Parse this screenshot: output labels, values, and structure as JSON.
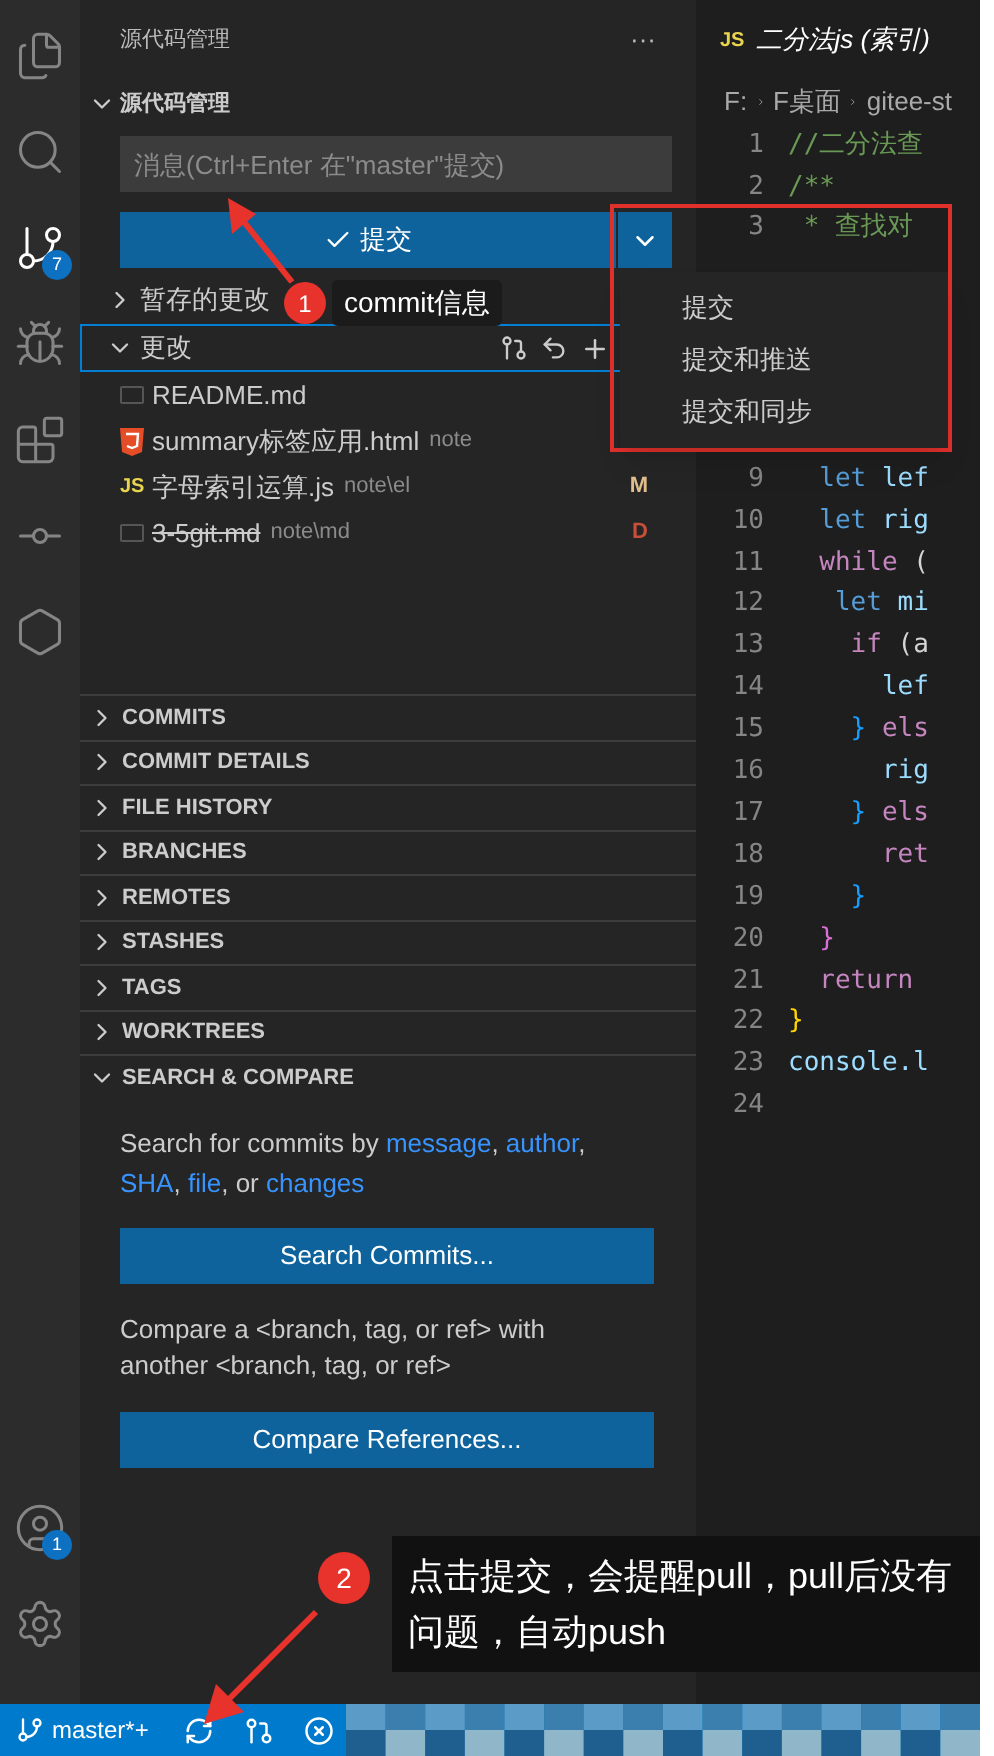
{
  "activity_bar": {
    "items": [
      {
        "kind": "files",
        "selected": false
      },
      {
        "kind": "search",
        "selected": false
      },
      {
        "kind": "scm",
        "selected": true,
        "badge": "7"
      },
      {
        "kind": "debug",
        "selected": false
      },
      {
        "kind": "extensions",
        "selected": false
      },
      {
        "kind": "gitlens",
        "selected": false
      },
      {
        "kind": "hexplay",
        "selected": false
      }
    ],
    "bottom": [
      {
        "kind": "account",
        "badge": "1"
      },
      {
        "kind": "settings"
      }
    ]
  },
  "sidebar": {
    "title": "源代码管理",
    "more": "···",
    "section": "源代码管理",
    "message_field": {
      "placeholder": "消息(Ctrl+Enter 在\"master\"提交)"
    },
    "commit_button": {
      "label": "提交"
    },
    "groups": [
      {
        "label": "暂存的更改",
        "focused": false
      },
      {
        "label": "更改",
        "focused": true
      }
    ],
    "files": [
      {
        "kind": "md",
        "name": "README.md",
        "deleted": false
      },
      {
        "kind": "html",
        "name": "summary标签应用.html",
        "path": "note",
        "deleted": false
      },
      {
        "kind": "js",
        "icon": "JS",
        "name": "字母索引运算.js",
        "path": "note\\el",
        "status": "M",
        "deleted": false
      },
      {
        "kind": "md",
        "name": "3-5git.md",
        "path": "note\\md",
        "status": "D",
        "deleted": true
      }
    ],
    "panels": [
      {
        "label": "COMMITS",
        "expanded": false
      },
      {
        "label": "COMMIT DETAILS",
        "expanded": false
      },
      {
        "label": "FILE HISTORY",
        "expanded": false
      },
      {
        "label": "BRANCHES",
        "expanded": false
      },
      {
        "label": "REMOTES",
        "expanded": false
      },
      {
        "label": "STASHES",
        "expanded": false
      },
      {
        "label": "TAGS",
        "expanded": false
      },
      {
        "label": "WORKTREES",
        "expanded": false
      },
      {
        "label": "SEARCH & COMPARE",
        "expanded": true
      }
    ],
    "search_text": [
      {
        "text": "Search for commits by ",
        "link": false
      },
      {
        "text": "message",
        "link": true
      },
      {
        "text": ", ",
        "link": false
      },
      {
        "text": "author",
        "link": true
      },
      {
        "text": ", ",
        "link": false
      },
      {
        "text": "SHA",
        "link": true
      },
      {
        "text": ", ",
        "link": false
      },
      {
        "text": "file",
        "link": true
      },
      {
        "text": ", or ",
        "link": false
      },
      {
        "text": "changes",
        "link": true
      }
    ],
    "search_button": "Search Commits...",
    "compare_text": "Compare a <branch, tag, or ref> with another <branch, tag, or ref>",
    "compare_button": "Compare References..."
  },
  "commit_menu": {
    "items": [
      "提交",
      "提交和推送",
      "提交和同步"
    ]
  },
  "editor": {
    "tab": {
      "icon": "JS",
      "title": "二分法js (索引)"
    },
    "breadcrumbs": [
      "F:",
      "F桌面",
      "gitee-st"
    ],
    "lines": [
      {
        "n": "1",
        "segments": [
          {
            "text": "//二分法查",
            "kind": "comment"
          }
        ]
      },
      {
        "n": "2",
        "segments": [
          {
            "text": "/**",
            "kind": "comment"
          }
        ]
      },
      {
        "n": "3",
        "segments": [
          {
            "text": " * 查找对",
            "kind": "comment"
          }
        ]
      },
      {
        "n": "9",
        "segments": [
          {
            "text": "  let ",
            "kind": "keyword"
          },
          {
            "text": "lef",
            "kind": "ident"
          }
        ]
      },
      {
        "n": "10",
        "segments": [
          {
            "text": "  let ",
            "kind": "keyword"
          },
          {
            "text": "rig",
            "kind": "ident"
          }
        ]
      },
      {
        "n": "11",
        "segments": [
          {
            "text": "  while ",
            "kind": "control"
          },
          {
            "text": "(",
            "kind": "punct"
          }
        ]
      },
      {
        "n": "12",
        "segments": [
          {
            "text": "   let ",
            "kind": "keyword"
          },
          {
            "text": "mi",
            "kind": "ident"
          }
        ]
      },
      {
        "n": "13",
        "segments": [
          {
            "text": "    if ",
            "kind": "control"
          },
          {
            "text": "(a",
            "kind": "punct"
          }
        ]
      },
      {
        "n": "14",
        "segments": [
          {
            "text": "      lef",
            "kind": "ident"
          }
        ]
      },
      {
        "n": "15",
        "segments": [
          {
            "text": "    } ",
            "kind": "bracket"
          },
          {
            "text": "els",
            "kind": "control"
          }
        ]
      },
      {
        "n": "16",
        "segments": [
          {
            "text": "      rig",
            "kind": "ident"
          }
        ]
      },
      {
        "n": "17",
        "segments": [
          {
            "text": "    } ",
            "kind": "bracket"
          },
          {
            "text": "els",
            "kind": "control"
          }
        ]
      },
      {
        "n": "18",
        "segments": [
          {
            "text": "      ret",
            "kind": "control"
          }
        ]
      },
      {
        "n": "19",
        "segments": [
          {
            "text": "    }",
            "kind": "bracket"
          }
        ]
      },
      {
        "n": "20",
        "segments": [
          {
            "text": "  }",
            "kind": "bracket2"
          }
        ]
      },
      {
        "n": "21",
        "segments": [
          {
            "text": "  return",
            "kind": "control"
          }
        ]
      },
      {
        "n": "22",
        "segments": [
          {
            "text": "}",
            "kind": "bracket3"
          }
        ]
      },
      {
        "n": "23",
        "segments": [
          {
            "text": "console.l",
            "kind": "ident"
          }
        ]
      },
      {
        "n": "24"
      }
    ]
  },
  "status_bar": {
    "branch": "master*+"
  },
  "annotations": [
    {
      "number": "1",
      "text": "commit信息"
    },
    {
      "number": "2",
      "text": "点击提交，会提醒pull，pull后没有问题，自动push"
    }
  ]
}
